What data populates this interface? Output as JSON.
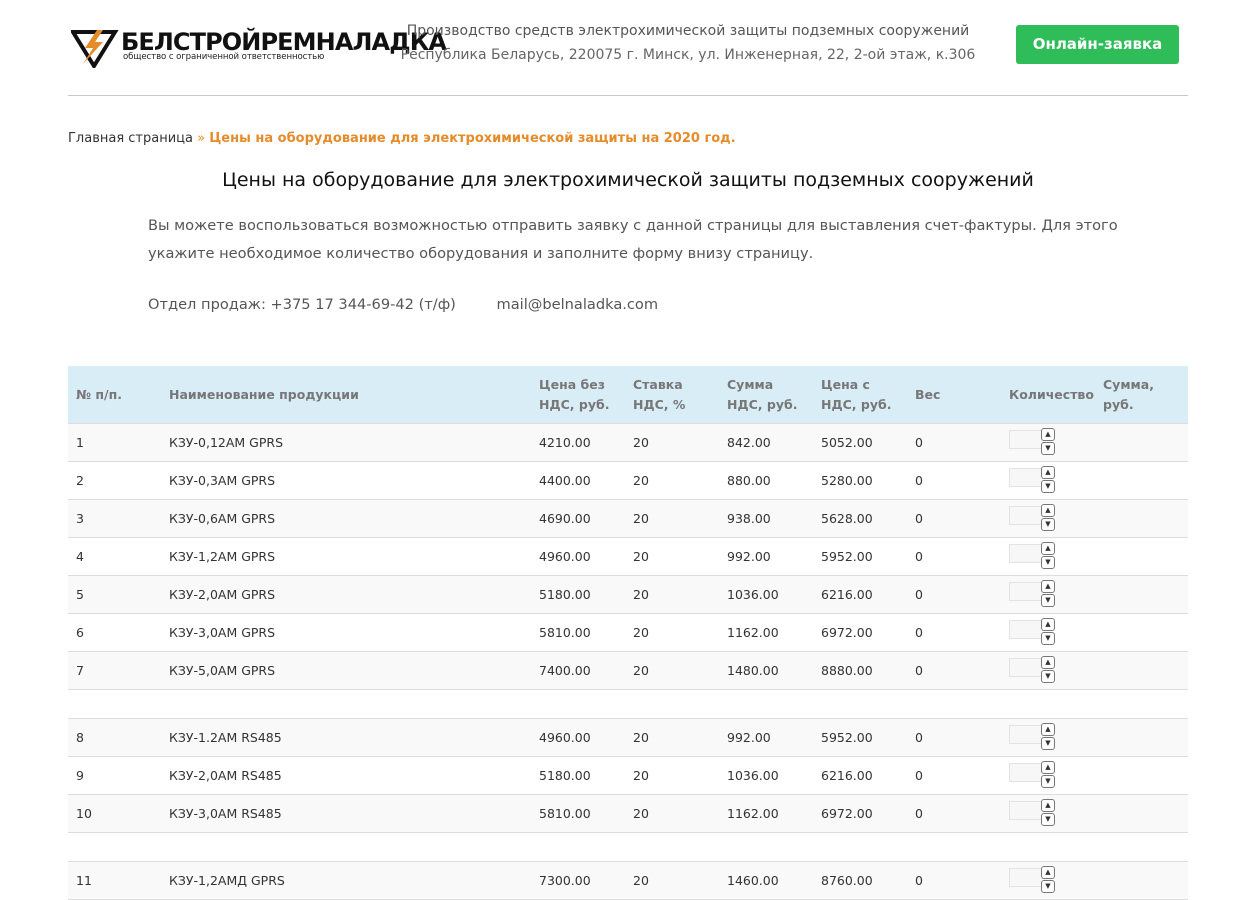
{
  "header": {
    "brand_name": "БЕЛСТРОЙРЕМНАЛАДКА",
    "brand_subtitle": "общество с ограниченной ответственностью",
    "tagline": "Производство средств электрохимической защиты подземных сооружений",
    "address": "Республика Беларусь, 220075 г. Минск, ул. Инженерная, 22, 2-ой этаж, к.306",
    "order_button": "Онлайн-заявка",
    "brand_color": "#e58b2a",
    "button_color": "#2ebd59"
  },
  "breadcrumb": {
    "home": "Главная страница",
    "separator": "»",
    "current": "Цены на оборудование для электрохимической защиты на 2020 год."
  },
  "page": {
    "title": "Цены на оборудование для электрохимической защиты подземных сооружений",
    "intro": "Вы можете воспользоваться возможностью отправить заявку с данной страницы для выставления счет-фактуры. Для этого укажите необходимое количество оборудования и заполните форму внизу страницу.",
    "sales_phone": "Отдел продаж: +375 17 344-69-42 (т/ф)",
    "email": "mail@belnaladka.com"
  },
  "table": {
    "header_color": "#d9edf7",
    "columns": [
      "№ п/п.",
      "Наименование продукции",
      "Цена без НДС, руб.",
      "Ставка НДС, %",
      "Сумма НДС, руб.",
      "Цена с НДС, руб.",
      "Вес",
      "Количество",
      "Сумма, руб."
    ],
    "groups": [
      {
        "rows": [
          {
            "n": "1",
            "name": "КЗУ-0,12АМ GPRS",
            "price": "4210.00",
            "vat_rate": "20",
            "vat_sum": "842.00",
            "price_vat": "5052.00",
            "weight": "0",
            "qty": "",
            "total": ""
          },
          {
            "n": "2",
            "name": "КЗУ-0,3АМ GPRS",
            "price": "4400.00",
            "vat_rate": "20",
            "vat_sum": "880.00",
            "price_vat": "5280.00",
            "weight": "0",
            "qty": "",
            "total": ""
          },
          {
            "n": "3",
            "name": "КЗУ-0,6АМ GPRS",
            "price": "4690.00",
            "vat_rate": "20",
            "vat_sum": "938.00",
            "price_vat": "5628.00",
            "weight": "0",
            "qty": "",
            "total": ""
          },
          {
            "n": "4",
            "name": "КЗУ-1,2АМ GPRS",
            "price": "4960.00",
            "vat_rate": "20",
            "vat_sum": "992.00",
            "price_vat": "5952.00",
            "weight": "0",
            "qty": "",
            "total": ""
          },
          {
            "n": "5",
            "name": "КЗУ-2,0АМ GPRS",
            "price": "5180.00",
            "vat_rate": "20",
            "vat_sum": "1036.00",
            "price_vat": "6216.00",
            "weight": "0",
            "qty": "",
            "total": ""
          },
          {
            "n": "6",
            "name": "КЗУ-3,0АМ GPRS",
            "price": "5810.00",
            "vat_rate": "20",
            "vat_sum": "1162.00",
            "price_vat": "6972.00",
            "weight": "0",
            "qty": "",
            "total": ""
          },
          {
            "n": "7",
            "name": "КЗУ-5,0АМ GPRS",
            "price": "7400.00",
            "vat_rate": "20",
            "vat_sum": "1480.00",
            "price_vat": "8880.00",
            "weight": "0",
            "qty": "",
            "total": ""
          }
        ]
      },
      {
        "rows": [
          {
            "n": "8",
            "name": "КЗУ-1.2АМ RS485",
            "price": "4960.00",
            "vat_rate": "20",
            "vat_sum": "992.00",
            "price_vat": "5952.00",
            "weight": "0",
            "qty": "",
            "total": ""
          },
          {
            "n": "9",
            "name": "КЗУ-2,0АМ RS485",
            "price": "5180.00",
            "vat_rate": "20",
            "vat_sum": "1036.00",
            "price_vat": "6216.00",
            "weight": "0",
            "qty": "",
            "total": ""
          },
          {
            "n": "10",
            "name": "КЗУ-3,0АМ RS485",
            "price": "5810.00",
            "vat_rate": "20",
            "vat_sum": "1162.00",
            "price_vat": "6972.00",
            "weight": "0",
            "qty": "",
            "total": ""
          }
        ]
      },
      {
        "rows": [
          {
            "n": "11",
            "name": "КЗУ-1,2АМД GPRS",
            "price": "7300.00",
            "vat_rate": "20",
            "vat_sum": "1460.00",
            "price_vat": "8760.00",
            "weight": "0",
            "qty": "",
            "total": ""
          }
        ]
      }
    ]
  }
}
